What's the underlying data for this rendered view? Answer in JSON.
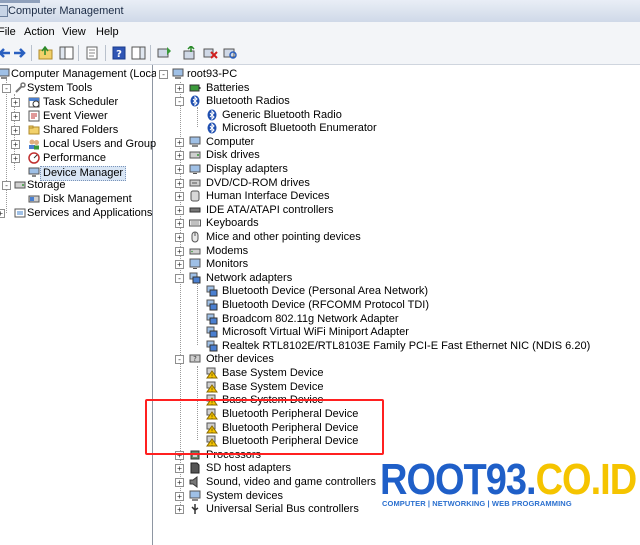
{
  "window": {
    "title": "Computer Management"
  },
  "menu": [
    "File",
    "Action",
    "View",
    "Help"
  ],
  "toolbar": {
    "buttons": [
      "back-arrow-icon",
      "forward-arrow-icon",
      "up-folder-icon",
      "show-tree-icon",
      "properties-icon",
      "help-icon",
      "show-hide-icon",
      "update-driver-icon",
      "uninstall-icon",
      "scan-hardware-icon"
    ]
  },
  "left_tree": {
    "root": "Computer Management (Local)",
    "system_tools": "System Tools",
    "task_scheduler": "Task Scheduler",
    "event_viewer": "Event Viewer",
    "shared_folders": "Shared Folders",
    "local_users": "Local Users and Groups",
    "performance": "Performance",
    "device_manager": "Device Manager",
    "storage": "Storage",
    "disk_management": "Disk Management",
    "services": "Services and Applications"
  },
  "device_tree": {
    "root": "root93-PC",
    "batteries": "Batteries",
    "bluetooth_radios": "Bluetooth Radios",
    "bt_generic": "Generic Bluetooth Radio",
    "bt_ms_enum": "Microsoft Bluetooth Enumerator",
    "computer": "Computer",
    "disk_drives": "Disk drives",
    "display_adapters": "Display adapters",
    "dvd": "DVD/CD-ROM drives",
    "hid": "Human Interface Devices",
    "ide": "IDE ATA/ATAPI controllers",
    "keyboards": "Keyboards",
    "mice": "Mice and other pointing devices",
    "modems": "Modems",
    "monitors": "Monitors",
    "network_adapters": "Network adapters",
    "net_bt_pan": "Bluetooth Device (Personal Area Network)",
    "net_bt_rfcomm": "Bluetooth Device (RFCOMM Protocol TDI)",
    "net_broadcom": "Broadcom 802.11g Network Adapter",
    "net_ms_wifi": "Microsoft Virtual WiFi Miniport Adapter",
    "net_realtek": "Realtek RTL8102E/RTL8103E Family PCI-E Fast Ethernet NIC (NDIS 6.20)",
    "other_devices": "Other devices",
    "other_base1": "Base System Device",
    "other_base2": "Base System Device",
    "other_base3": "Base System Device",
    "other_btp1": "Bluetooth Peripheral Device",
    "other_btp2": "Bluetooth Peripheral Device",
    "other_btp3": "Bluetooth Peripheral Device",
    "processors": "Processors",
    "sd_host": "SD host adapters",
    "sound": "Sound, video and game controllers",
    "system_devices": "System devices",
    "usb": "Universal Serial Bus controllers"
  },
  "watermark": {
    "part1": "ROOT93.",
    "part2": "CO.ID",
    "tagline": "COMPUTER | NETWORKING | WEB PROGRAMMING",
    "color_blue": "#1f5fc8",
    "color_yellow": "#f5c400"
  }
}
